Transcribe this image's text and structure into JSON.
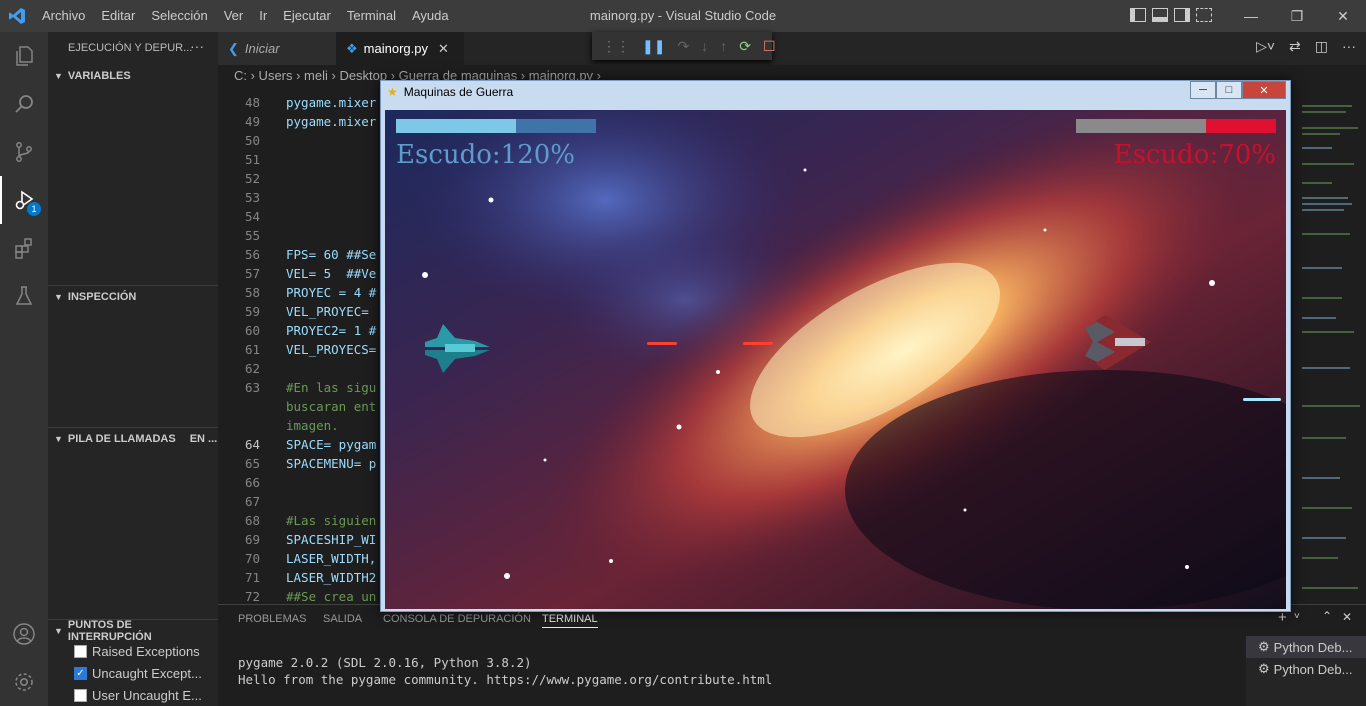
{
  "window": {
    "title": "mainorg.py - Visual Studio Code"
  },
  "menu": [
    "Archivo",
    "Editar",
    "Selección",
    "Ver",
    "Ir",
    "Ejecutar",
    "Terminal",
    "Ayuda"
  ],
  "sidebar": {
    "title": "EJECUCIÓN Y DEPUR...",
    "sections": {
      "variables": "VARIABLES",
      "inspeccion": "INSPECCIÓN",
      "pila": "PILA DE LLAMADAS",
      "pila_status": "EN ...",
      "puntos": "PUNTOS DE INTERRUPCIÓN"
    },
    "breakpoints": [
      {
        "label": "Raised Exceptions",
        "checked": false
      },
      {
        "label": "Uncaught Except...",
        "checked": true
      },
      {
        "label": "User Uncaught E...",
        "checked": false
      }
    ]
  },
  "activity": {
    "debug_badge": "1"
  },
  "tabs": [
    {
      "label": "Iniciar"
    },
    {
      "label": "mainorg.py"
    }
  ],
  "breadcrumb": "C: › Users › meli › Desktop › Guerra de maquinas › mainorg.py ›",
  "code": [
    {
      "line": "48",
      "text": "pygame.mixer",
      "comment": false
    },
    {
      "line": "49",
      "text": "pygame.mixer",
      "comment": false
    },
    {
      "line": "50",
      "text": "",
      "comment": false
    },
    {
      "line": "51",
      "text": "",
      "comment": false
    },
    {
      "line": "52",
      "text": "",
      "comment": false
    },
    {
      "line": "53",
      "text": "",
      "comment": false
    },
    {
      "line": "54",
      "text": "",
      "comment": false
    },
    {
      "line": "55",
      "text": "",
      "comment": false
    },
    {
      "line": "56",
      "text": "FPS= 60 ##Se",
      "comment": false
    },
    {
      "line": "57",
      "text": "VEL= 5  ##Ve",
      "comment": false
    },
    {
      "line": "58",
      "text": "PROYEC = 4 #",
      "comment": false
    },
    {
      "line": "59",
      "text": "VEL_PROYEC=",
      "comment": false
    },
    {
      "line": "60",
      "text": "PROYEC2= 1 #",
      "comment": false
    },
    {
      "line": "61",
      "text": "VEL_PROYECS=",
      "comment": false
    },
    {
      "line": "62",
      "text": "",
      "comment": false
    },
    {
      "line": "63",
      "text": "#En las sigu",
      "comment": true
    },
    {
      "line": "",
      "text": "buscaran ent",
      "comment": true
    },
    {
      "line": "",
      "text": "imagen.",
      "comment": true
    },
    {
      "line": "64",
      "text": "SPACE= pygam",
      "comment": false
    },
    {
      "line": "65",
      "text": "SPACEMENU= p",
      "comment": false
    },
    {
      "line": "66",
      "text": "",
      "comment": false
    },
    {
      "line": "67",
      "text": "",
      "comment": false
    },
    {
      "line": "68",
      "text": "#Las siguien",
      "comment": true
    },
    {
      "line": "69",
      "text": "SPACESHIP_WI",
      "comment": false
    },
    {
      "line": "70",
      "text": "LASER_WIDTH,",
      "comment": false
    },
    {
      "line": "71",
      "text": "LASER_WIDTH2",
      "comment": false
    },
    {
      "line": "72",
      "text": "##Se crea un",
      "comment": true
    }
  ],
  "panel": {
    "tabs": [
      "PROBLEMAS",
      "SALIDA",
      "CONSOLA DE DEPURACIÓN",
      "TERMINAL"
    ],
    "terminal_lines": [
      "pygame 2.0.2 (SDL 2.0.16, Python 3.8.2)",
      "Hello from the pygame community. https://www.pygame.org/contribute.html"
    ],
    "terminals": [
      "Python Deb...",
      "Python Deb..."
    ]
  },
  "game": {
    "window_title": "Maquinas de Guerra",
    "left_shield": "Escudo:120%",
    "right_shield": "Escudo:70%",
    "left_health": 0.6,
    "right_health": 0.35,
    "colors": {
      "left": "#5e9ccb",
      "right": "#c8102e",
      "left_bar": "#7cc8e6",
      "right_bar": "#e01030"
    }
  }
}
